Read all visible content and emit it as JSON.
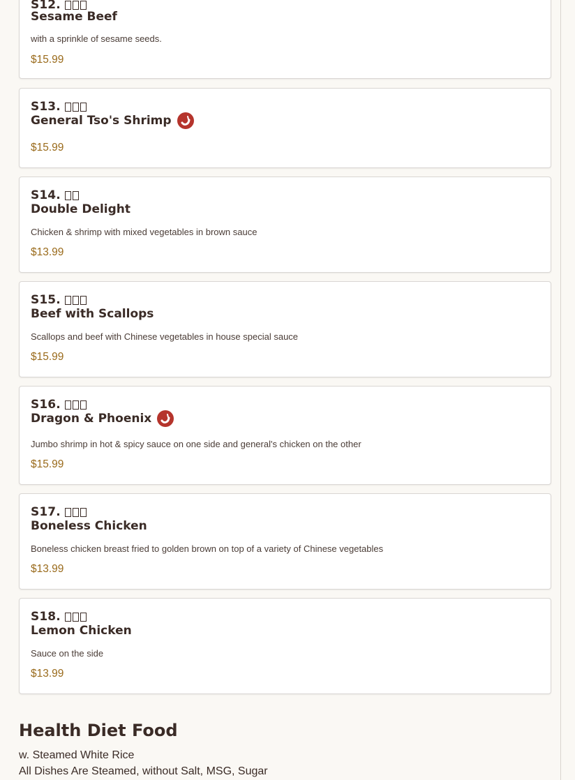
{
  "menu_items": [
    {
      "code": "S12.",
      "cjk_count": 3,
      "name": "Sesame Beef",
      "spicy": false,
      "description": "with a sprinkle of sesame seeds.",
      "price": "$15.99"
    },
    {
      "code": "S13.",
      "cjk_count": 3,
      "name": "General Tso's Shrimp",
      "spicy": true,
      "description": "",
      "price": "$15.99"
    },
    {
      "code": "S14.",
      "cjk_count": 2,
      "name": "Double Delight",
      "spicy": false,
      "description": "Chicken & shrimp with mixed vegetables in brown sauce",
      "price": "$13.99"
    },
    {
      "code": "S15.",
      "cjk_count": 3,
      "name": "Beef with Scallops",
      "spicy": false,
      "description": "Scallops and beef with Chinese vegetables in house special sauce",
      "price": "$15.99"
    },
    {
      "code": "S16.",
      "cjk_count": 3,
      "name": "Dragon & Phoenix",
      "spicy": true,
      "description": "Jumbo shrimp in hot & spicy sauce on one side and general's chicken on the other",
      "price": "$15.99"
    },
    {
      "code": "S17.",
      "cjk_count": 3,
      "name": "Boneless Chicken",
      "spicy": false,
      "description": "Boneless chicken breast fried to golden brown on top of a variety of Chinese vegetables",
      "price": "$13.99"
    },
    {
      "code": "S18.",
      "cjk_count": 3,
      "name": "Lemon Chicken",
      "spicy": false,
      "description": "Sauce on the side",
      "price": "$13.99"
    }
  ],
  "section": {
    "title": "Health Diet Food",
    "subtitle_1": "w. Steamed White Rice",
    "subtitle_2": "All Dishes Are Steamed, without Salt, MSG, Sugar"
  },
  "colors": {
    "price": "#9a6b1c",
    "spicy_badge": "#b5342c",
    "text": "#3a2b26"
  },
  "icons": {
    "spicy": "chili-pepper-icon"
  }
}
